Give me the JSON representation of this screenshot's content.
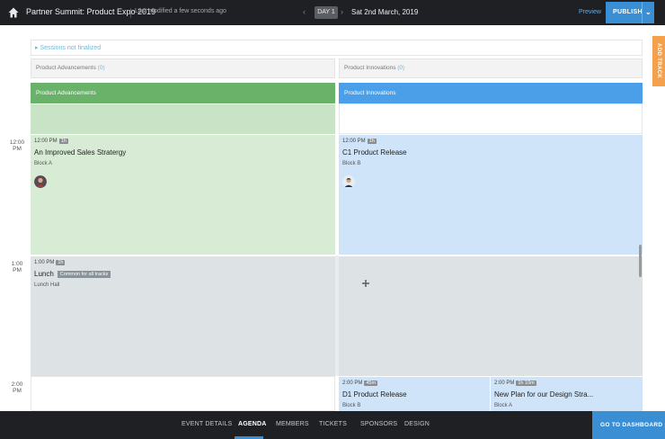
{
  "header": {
    "event_title": "Partner Summit: Product Expo 2019",
    "last_modified": "Last modified a few seconds ago",
    "day_label": "DAY 1",
    "date": "Sat 2nd March, 2019",
    "preview": "Preview",
    "publish": "PUBLISH"
  },
  "add_track": "ADD TRACK",
  "not_finalized": "Sessions not finalized",
  "tracks": [
    {
      "name": "Product Advancements",
      "count": "(0)",
      "color": "#6ab26a"
    },
    {
      "name": "Product Innovations",
      "count": "(0)",
      "color": "#4a9fe8"
    }
  ],
  "times": [
    "12:00",
    "PM",
    "1:00",
    "PM",
    "2:00",
    "PM"
  ],
  "sessions": {
    "a1": {
      "time": "12:00 PM",
      "duration": "1h",
      "title": "An Improved Sales Stratergy",
      "location": "Block A"
    },
    "b1": {
      "time": "12:00 PM",
      "duration": "1h",
      "title": "C1 Product Release",
      "location": "Block B"
    },
    "lunch": {
      "time": "1:00 PM",
      "duration": "1h",
      "title": "Lunch",
      "badge": "Common for all tracks",
      "location": "Lunch Hall"
    },
    "b2": {
      "time": "2:00 PM",
      "duration": "45m",
      "title": "D1 Product Release",
      "location": "Block B"
    },
    "b3": {
      "time": "2:00 PM",
      "duration": "1h 10m",
      "title": "New Plan for our Design Stra...",
      "location": "Block A"
    }
  },
  "nav": {
    "items": [
      "EVENT DETAILS",
      "AGENDA",
      "MEMBERS",
      "TICKETS",
      "SPONSORS",
      "DESIGN"
    ],
    "active": "AGENDA",
    "dashboard": "GO TO DASHBOARD"
  }
}
